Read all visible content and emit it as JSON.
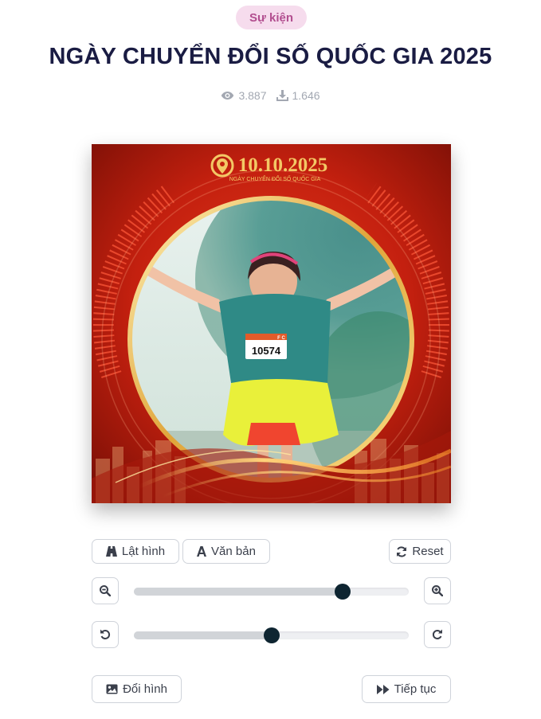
{
  "category": {
    "label": "Sự kiện"
  },
  "page": {
    "title": "NGÀY CHUYỂN ĐỔI SỐ QUỐC GIA 2025"
  },
  "stats": {
    "views": "3.887",
    "downloads": "1.646",
    "views_icon": "eye-icon",
    "downloads_icon": "download-icon"
  },
  "frame": {
    "date_text": "10.10.2025",
    "subtitle": "NGÀY CHUYỂN ĐỔI SỐ QUỐC GIA",
    "bib_number": "10574",
    "bib_suffix": "F C",
    "colors": {
      "red": "#c4200f",
      "dark_red": "#8d1207",
      "gold": "#f3c865"
    }
  },
  "toolbar": {
    "flip_label": "Lật hình",
    "flip_icon": "road-icon",
    "text_label": "Văn bản",
    "text_icon": "font-icon",
    "reset_label": "Reset",
    "reset_icon": "refresh-icon"
  },
  "zoom": {
    "value": 0.76,
    "out_icon": "zoom-out-icon",
    "in_icon": "zoom-in-icon"
  },
  "rotate": {
    "value": 0.5,
    "left_icon": "rotate-left-icon",
    "right_icon": "rotate-right-icon"
  },
  "footer": {
    "change_label": "Đổi hình",
    "change_icon": "image-icon",
    "continue_label": "Tiếp tục",
    "continue_icon": "fast-forward-icon"
  },
  "colors": {
    "accent": "#0e2531",
    "tag_bg": "#f6dced",
    "tag_text": "#b24e8f",
    "muted": "#a3a8b2"
  }
}
